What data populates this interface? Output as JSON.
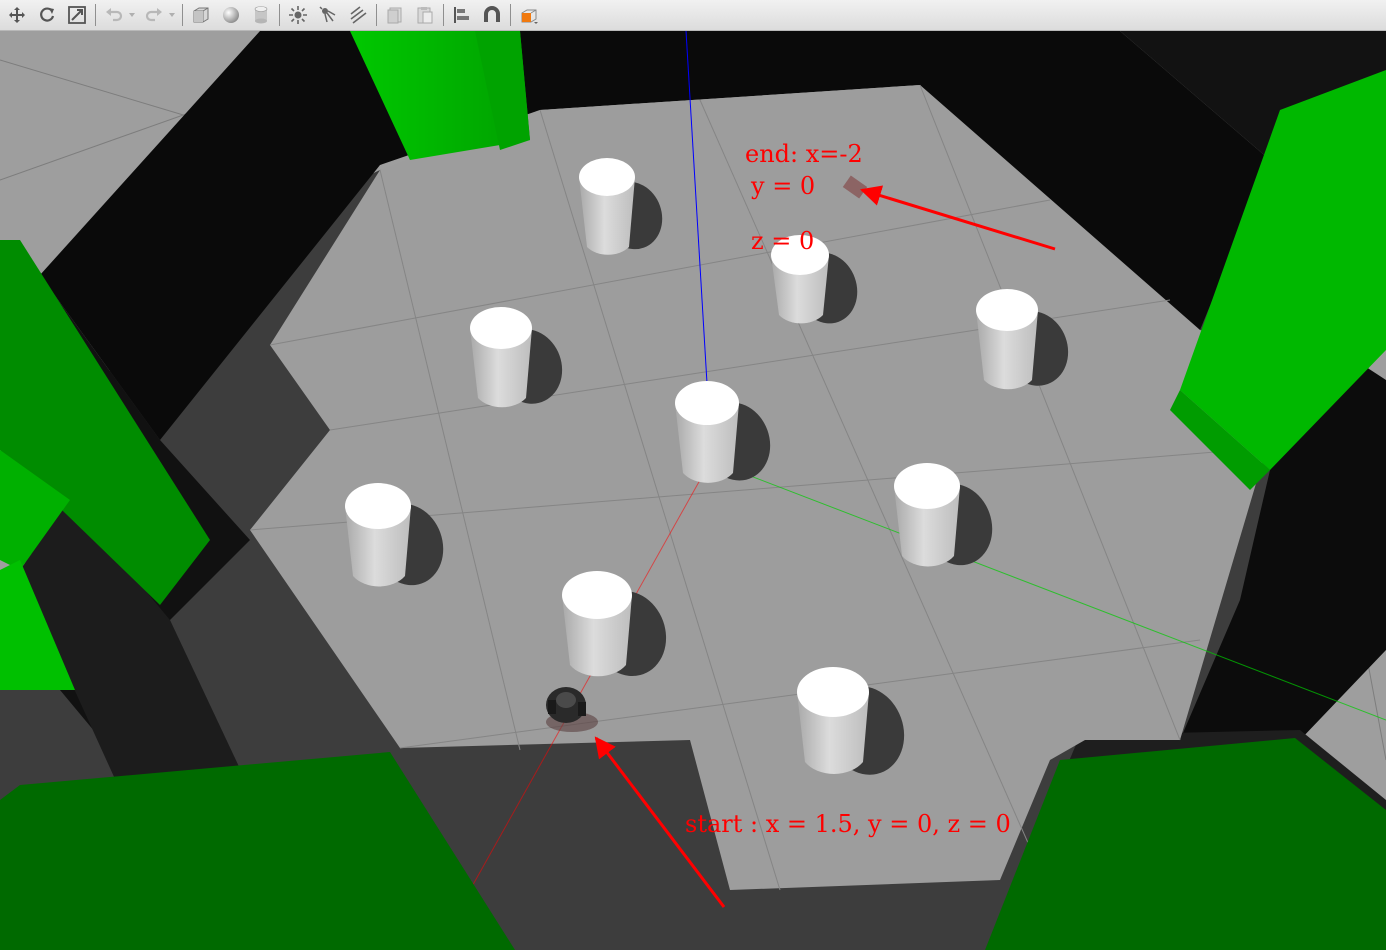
{
  "toolbar": {
    "tools": [
      {
        "name": "translate-mode",
        "icon": "move-icon",
        "enabled": true
      },
      {
        "name": "rotate-mode",
        "icon": "rotate-icon",
        "enabled": true
      },
      {
        "name": "scale-mode",
        "icon": "scale-icon",
        "enabled": true
      },
      {
        "name": "undo",
        "icon": "undo-icon",
        "enabled": false
      },
      {
        "name": "redo",
        "icon": "redo-icon",
        "enabled": false
      },
      {
        "name": "insert-box",
        "icon": "box-shape-icon",
        "enabled": true
      },
      {
        "name": "insert-sphere",
        "icon": "sphere-shape-icon",
        "enabled": true
      },
      {
        "name": "insert-cylinder",
        "icon": "cylinder-shape-icon",
        "enabled": true
      },
      {
        "name": "point-light",
        "icon": "point-light-icon",
        "enabled": true
      },
      {
        "name": "spot-light",
        "icon": "spot-light-icon",
        "enabled": true
      },
      {
        "name": "directional-light",
        "icon": "directional-light-icon",
        "enabled": true
      },
      {
        "name": "copy",
        "icon": "copy-icon",
        "enabled": false
      },
      {
        "name": "paste",
        "icon": "paste-icon",
        "enabled": false
      },
      {
        "name": "align",
        "icon": "align-icon",
        "enabled": true
      },
      {
        "name": "snap",
        "icon": "magnet-icon",
        "enabled": true
      },
      {
        "name": "change-view",
        "icon": "view-cube-icon",
        "enabled": true
      }
    ]
  },
  "annotations": {
    "end_line1": "end: x=-2",
    "end_line2": "y = 0",
    "end_line3": "z = 0",
    "start": "start : x = 1.5, y = 0, z = 0"
  },
  "colors": {
    "annotation": "#ff0000",
    "wall_green": "#00b300",
    "wall_green_dark": "#006600",
    "ground": "#a0a0a0",
    "floor": "#9c9c9c",
    "x_axis": "#ff0000",
    "y_axis": "#00cc00",
    "z_axis": "#0000ff"
  }
}
